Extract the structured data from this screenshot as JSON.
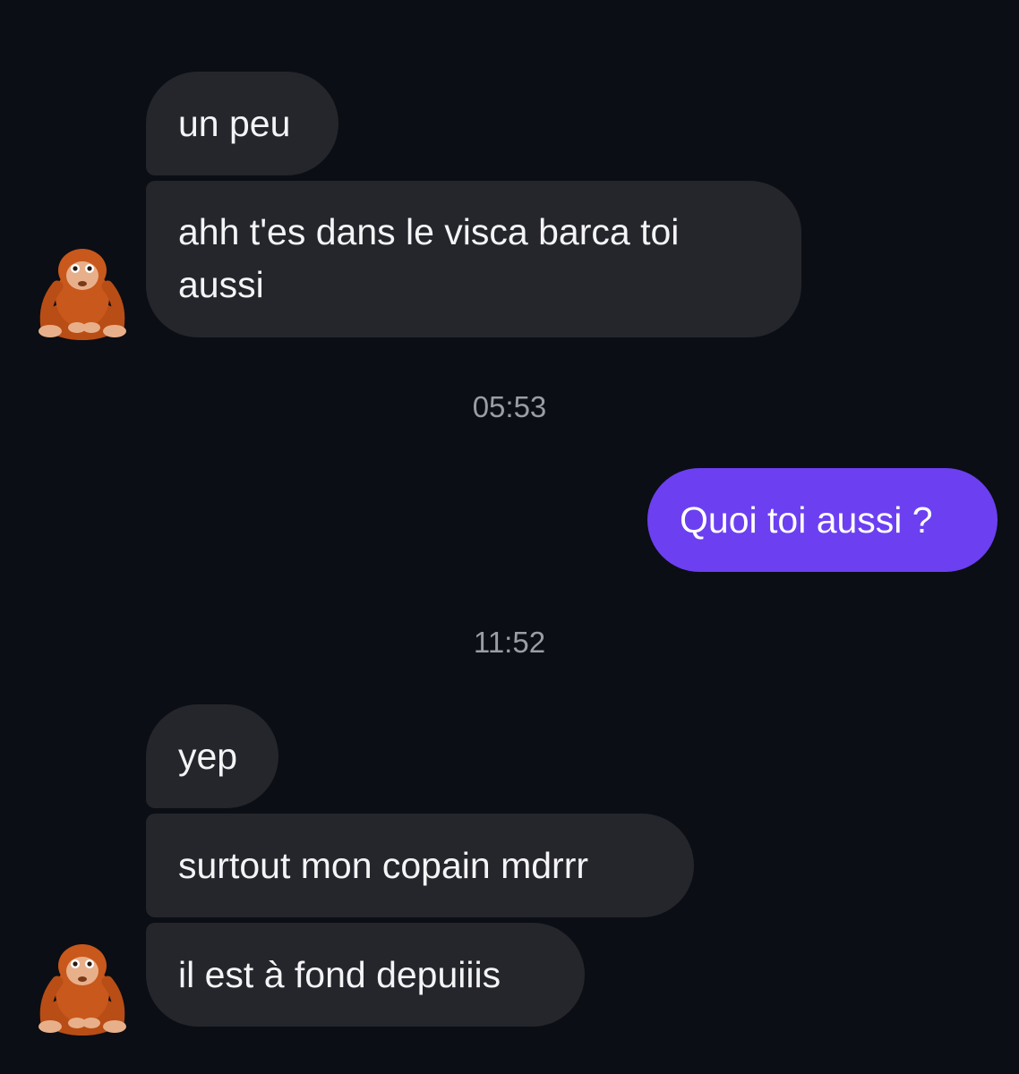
{
  "messages": [
    {
      "id": "m1",
      "direction": "incoming",
      "text": "un peu"
    },
    {
      "id": "m2",
      "direction": "incoming",
      "text": "ahh t'es dans le visca barca toi aussi"
    },
    {
      "id": "m3",
      "direction": "outgoing",
      "text": "Quoi toi aussi ?"
    },
    {
      "id": "m4",
      "direction": "incoming",
      "text": "yep"
    },
    {
      "id": "m5",
      "direction": "incoming",
      "text": "surtout mon copain mdrrr"
    },
    {
      "id": "m6",
      "direction": "incoming",
      "text": "il est à fond depuiiis"
    }
  ],
  "timestamps": [
    "05:53",
    "11:52"
  ],
  "contact": {
    "avatar_icon": "orangutan-icon"
  },
  "colors": {
    "background": "#0b0e14",
    "incoming_bubble": "#24262c",
    "outgoing_bubble": "#6c3ff1",
    "timestamp_text": "#9a9da4"
  }
}
